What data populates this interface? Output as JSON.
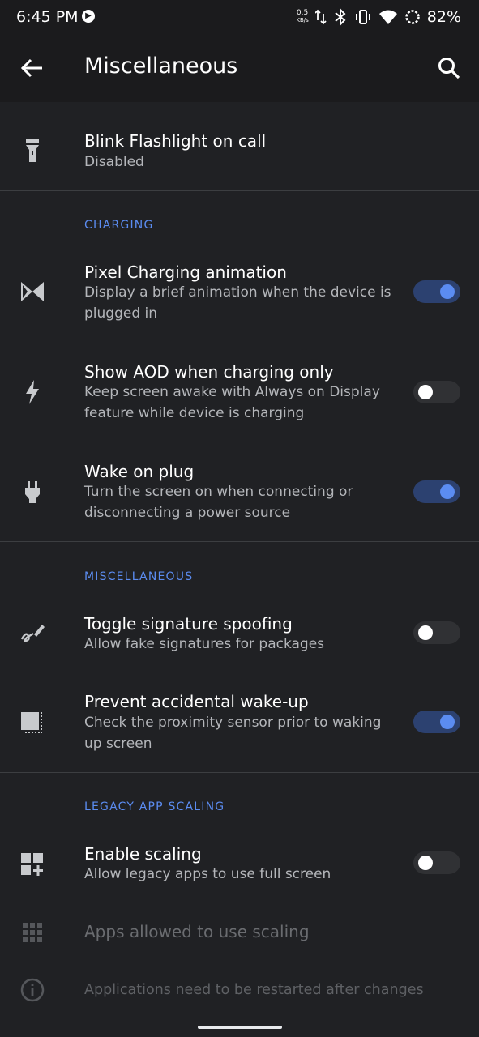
{
  "status": {
    "time": "6:45 PM",
    "net_speed_value": "0.5",
    "net_speed_unit": "KB/s",
    "battery": "82%"
  },
  "header": {
    "title": "Miscellaneous"
  },
  "items": [
    {
      "title": "Blink Flashlight on call",
      "summary": "Disabled",
      "icon": "flashlight-icon"
    },
    {
      "title": "Pixel Charging animation",
      "summary": "Display a brief animation when the device is plugged in",
      "icon": "charging-animation-icon",
      "enabled": true
    },
    {
      "title": "Show AOD when charging only",
      "summary": "Keep screen awake with Always on Display feature while device is charging",
      "icon": "bolt-icon",
      "enabled": false
    },
    {
      "title": "Wake on plug",
      "summary": "Turn the screen on when connecting or disconnecting a power source",
      "icon": "plug-icon",
      "enabled": true
    },
    {
      "title": "Toggle signature spoofing",
      "summary": "Allow fake signatures for packages",
      "icon": "signature-icon",
      "enabled": false
    },
    {
      "title": "Prevent accidental wake-up",
      "summary": "Check the proximity sensor prior to waking up screen",
      "icon": "proximity-icon",
      "enabled": true
    },
    {
      "title": "Enable scaling",
      "summary": "Allow legacy apps to use full screen",
      "icon": "scaling-icon",
      "enabled": false
    },
    {
      "title": "Apps allowed to use scaling",
      "icon": "apps-grid-icon",
      "disabled": true
    },
    {
      "summary": "Applications need to be restarted after changes",
      "icon": "info-icon",
      "disabled": true
    }
  ],
  "sections": {
    "charging": "CHARGING",
    "misc": "MISCELLANEOUS",
    "legacy": "LEGACY APP SCALING"
  },
  "colors": {
    "background": "#202124",
    "appbar": "#1b1b1d",
    "accent": "#5b8cf1",
    "switch_on_track": "#2c4170",
    "secondary_text": "#b4b6ba"
  }
}
